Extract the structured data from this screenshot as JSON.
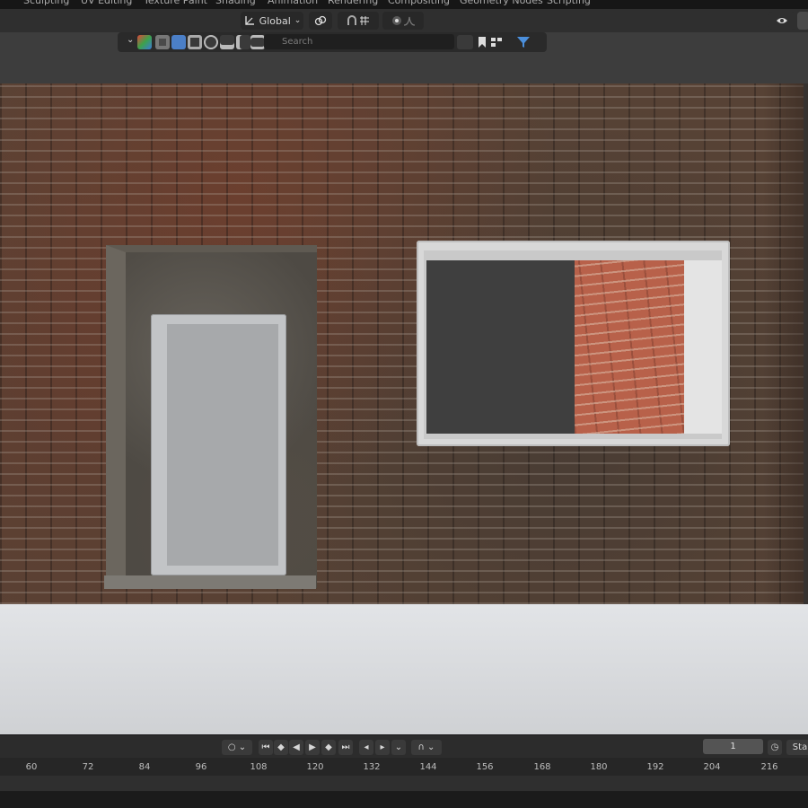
{
  "tabs": [
    "Sculpting",
    "UV Editing",
    "Texture Paint",
    "Shading",
    "Animation",
    "Rendering",
    "Compositing",
    "Geometry Nodes",
    "Scripting"
  ],
  "header": {
    "orientation": "Global",
    "search_placeholder": "Search"
  },
  "timeline": {
    "current_frame": "1",
    "start_label": "Sta",
    "ticks": [
      "60",
      "72",
      "84",
      "96",
      "108",
      "120",
      "132",
      "144",
      "156",
      "168",
      "180",
      "192",
      "204",
      "216"
    ]
  },
  "icons": [
    "transform-orientation-icon",
    "pivot-icon",
    "snap-icon",
    "proportional-icon",
    "overlay-icon",
    "gizmo-icon",
    "filter-icon",
    "search-icon",
    "play-icon",
    "keyframe-icon",
    "stopwatch-icon"
  ]
}
